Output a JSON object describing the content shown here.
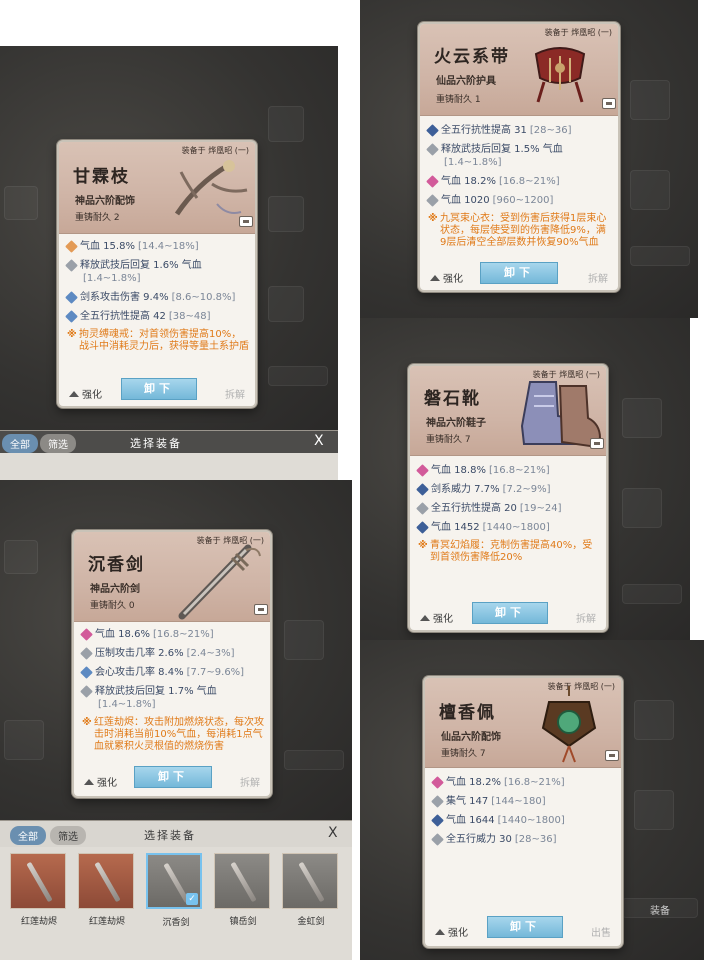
{
  "common": {
    "equipped_to": "装备于 烨凰昭 (一)",
    "enhance": "强化",
    "dismantle": "拆解",
    "unequip": "卸下",
    "sell": "出售"
  },
  "cards": {
    "ganlin": {
      "name": "甘霖枝",
      "grade": "神品六阶配饰",
      "recast": "重铸耐久 2",
      "stats": [
        {
          "label": "气血 15.8%",
          "range": "[14.4~18%]",
          "color": "#e39a55"
        },
        {
          "label": "释放武技后回复 1.6% 气血",
          "range": "[1.4~1.8%]",
          "color": "#9aa0a8"
        },
        {
          "label": "剑系攻击伤害 9.4%",
          "range": "[8.6~10.8%]",
          "color": "#5d8ac2"
        },
        {
          "label": "全五行抗性提高 42",
          "range": "[38~48]",
          "color": "#5d8ac2"
        }
      ],
      "special": "拘灵缚魂戒：对首领伤害提高10%，战斗中消耗灵力后，获得等量土系护盾"
    },
    "huoyun": {
      "name": "火云系带",
      "grade": "仙品六阶护具",
      "recast": "重铸耐久 1",
      "stats": [
        {
          "label": "全五行抗性提高 31",
          "range": "[28~36]",
          "color": "#3d5f98"
        },
        {
          "label": "释放武技后回复 1.5% 气血",
          "range": "[1.4~1.8%]",
          "color": "#9aa0a8"
        },
        {
          "label": "气血 18.2%",
          "range": "[16.8~21%]",
          "color": "#d25a9a"
        },
        {
          "label": "气血 1020",
          "range": "[960~1200]",
          "color": "#9aa0a8"
        }
      ],
      "special": "九冥束心衣：受到伤害后获得1层束心状态，每层使受到的伤害降低9%，满9层后清空全部层数并恢复90%气血"
    },
    "chenxiang": {
      "name": "沉香剑",
      "grade": "神品六阶剑",
      "recast": "重铸耐久 0",
      "stats": [
        {
          "label": "气血 18.6%",
          "range": "[16.8~21%]",
          "color": "#d25a9a"
        },
        {
          "label": "压制攻击几率 2.6%",
          "range": "[2.4~3%]",
          "color": "#9aa0a8"
        },
        {
          "label": "会心攻击几率 8.4%",
          "range": "[7.7~9.6%]",
          "color": "#5d8ac2"
        },
        {
          "label": "释放武技后回复 1.7% 气血",
          "range": "[1.4~1.8%]",
          "color": "#9aa0a8"
        }
      ],
      "special": "红莲劫烬：攻击附加燃烧状态，每次攻击时消耗当前10%气血，每消耗1点气血就累积火灵根值的燃烧伤害"
    },
    "panshi": {
      "name": "磐石靴",
      "grade": "神品六阶鞋子",
      "recast": "重铸耐久 7",
      "stats": [
        {
          "label": "气血 18.8%",
          "range": "[16.8~21%]",
          "color": "#d25a9a"
        },
        {
          "label": "剑系威力 7.7%",
          "range": "[7.2~9%]",
          "color": "#3d5f98"
        },
        {
          "label": "全五行抗性提高 20",
          "range": "[19~24]",
          "color": "#9aa0a8"
        },
        {
          "label": "气血 1452",
          "range": "[1440~1800]",
          "color": "#3d5f98"
        }
      ],
      "special": "青冥幻焰履：克制伤害提高40%，受到首领伤害降低20%"
    },
    "tanxiang": {
      "name": "檀香佩",
      "grade": "仙品六阶配饰",
      "recast": "重铸耐久 7",
      "stats": [
        {
          "label": "气血 18.2%",
          "range": "[16.8~21%]",
          "color": "#d25a9a"
        },
        {
          "label": "集气 147",
          "range": "[144~180]",
          "color": "#9aa0a8"
        },
        {
          "label": "气血 1644",
          "range": "[1440~1800]",
          "color": "#3d5f98"
        },
        {
          "label": "全五行威力 30",
          "range": "[28~36]",
          "color": "#9aa0a8"
        }
      ]
    }
  },
  "selector": {
    "all": "全部",
    "filter": "筛选",
    "title": "选择装备",
    "close": "X",
    "items": [
      "红莲劫烬",
      "红莲劫烬",
      "沉香剑",
      "镇岳剑",
      "金虹剑"
    ]
  },
  "background_tabs": {
    "equip": "装备"
  }
}
